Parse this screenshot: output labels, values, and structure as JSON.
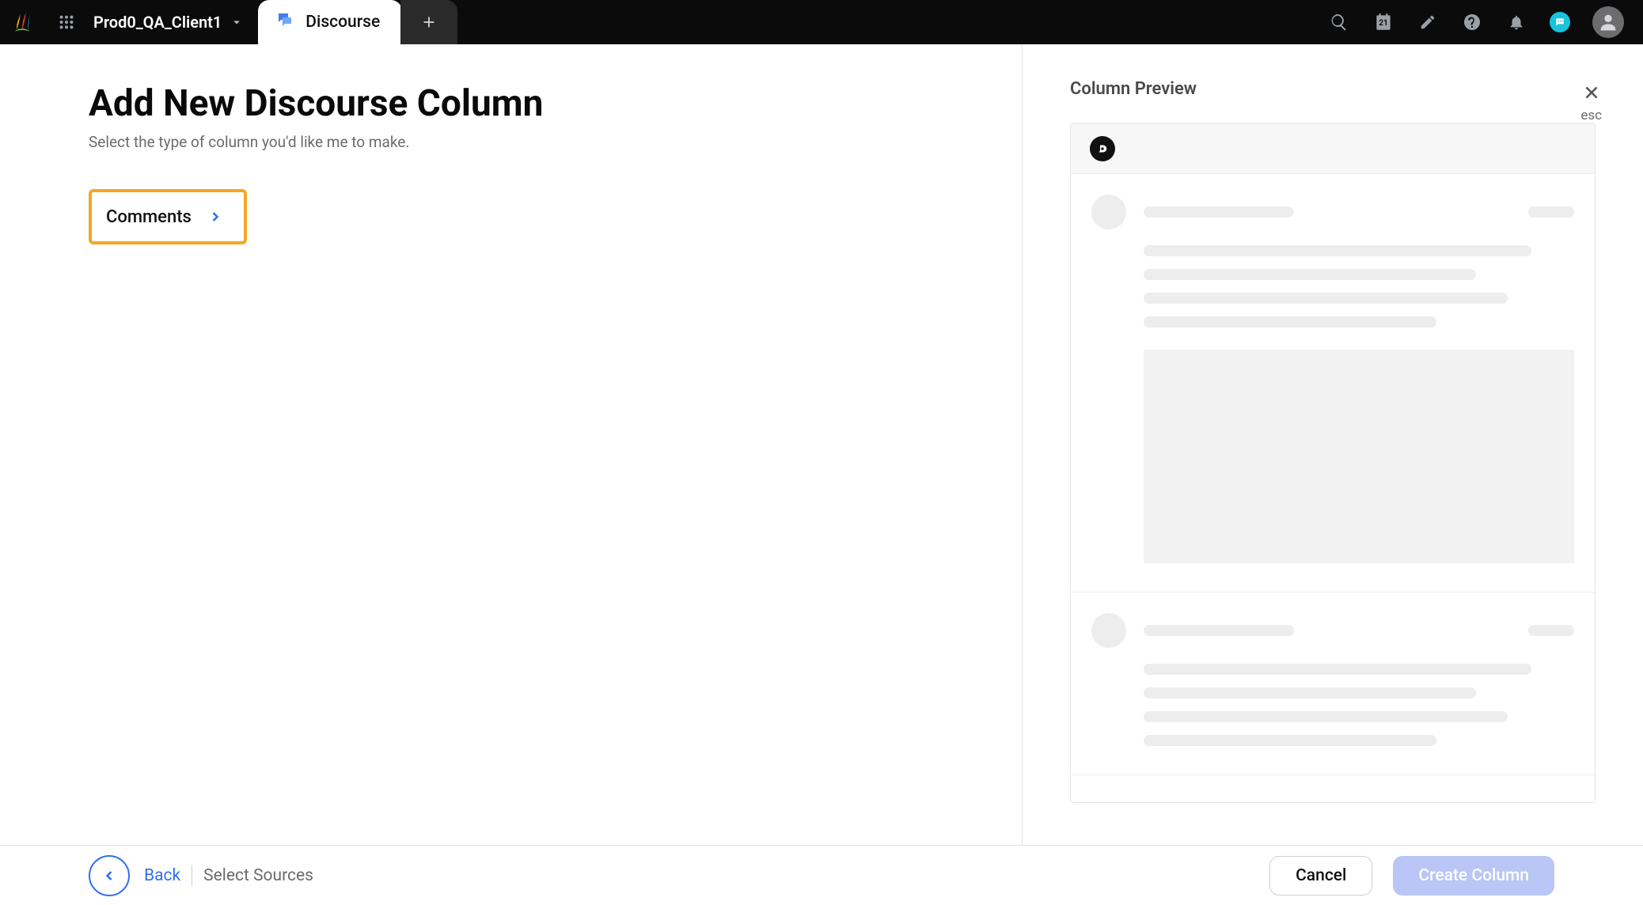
{
  "topbar": {
    "workspace_name": "Prod0_QA_Client1",
    "active_tab_label": "Discourse",
    "calendar_day": "21"
  },
  "page": {
    "title": "Add New Discourse Column",
    "subtitle": "Select the type of column you'd like me to make."
  },
  "options": {
    "comments_label": "Comments"
  },
  "preview": {
    "title": "Column Preview",
    "close_hint": "esc"
  },
  "footer": {
    "back_label": "Back",
    "breadcrumb": "Select Sources",
    "cancel_label": "Cancel",
    "create_label": "Create Column"
  }
}
